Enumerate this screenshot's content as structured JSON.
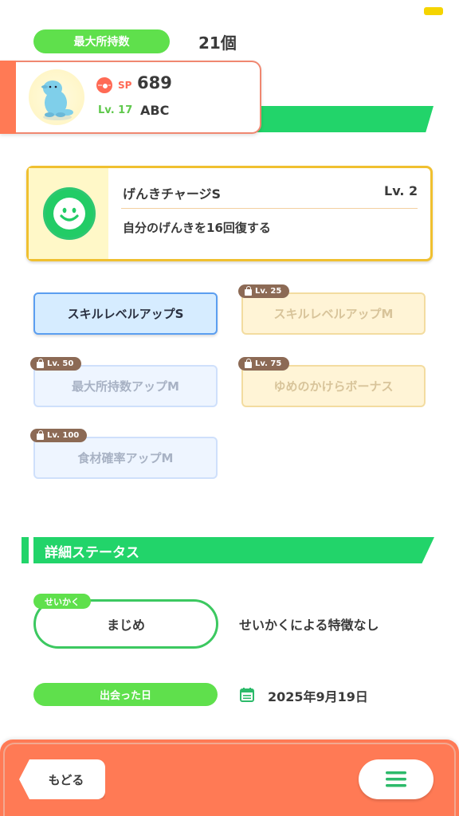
{
  "header": {
    "max_label": "最大所持数",
    "max_value": "21個"
  },
  "pokemon": {
    "sp_label": "SP",
    "sp_value": "689",
    "level": "Lv. 17",
    "name": "ABC"
  },
  "main_skill": {
    "name": "げんきチャージS",
    "level": "Lv. 2",
    "description": "自分のげんきを16回復する"
  },
  "sub_skills": [
    {
      "label": "スキルレベルアップS",
      "lock": "",
      "state": "unlocked"
    },
    {
      "label": "スキルレベルアップM",
      "lock": "Lv. 25",
      "state": "locked-gold"
    },
    {
      "label": "最大所持数アップM",
      "lock": "Lv. 50",
      "state": "locked-blue"
    },
    {
      "label": "ゆめのかけらボーナス",
      "lock": "Lv. 75",
      "state": "locked-gold"
    },
    {
      "label": "食材確率アップM",
      "lock": "Lv. 100",
      "state": "locked-blue"
    }
  ],
  "details": {
    "section_title": "詳細ステータス",
    "nature_tag": "せいかく",
    "nature_value": "まじめ",
    "nature_description": "せいかくによる特徴なし",
    "met_label": "出会った日",
    "met_date": "2025年9月19日"
  },
  "footer": {
    "back_label": "もどる"
  },
  "colors": {
    "accent_green": "#22d46a",
    "label_green": "#5fe04c",
    "footer_orange": "#ff7a55",
    "skill_border_gold": "#f0c030"
  },
  "icons": [
    "pokeball-icon",
    "smile-icon",
    "lock-icon",
    "calendar-icon",
    "menu-icon"
  ]
}
